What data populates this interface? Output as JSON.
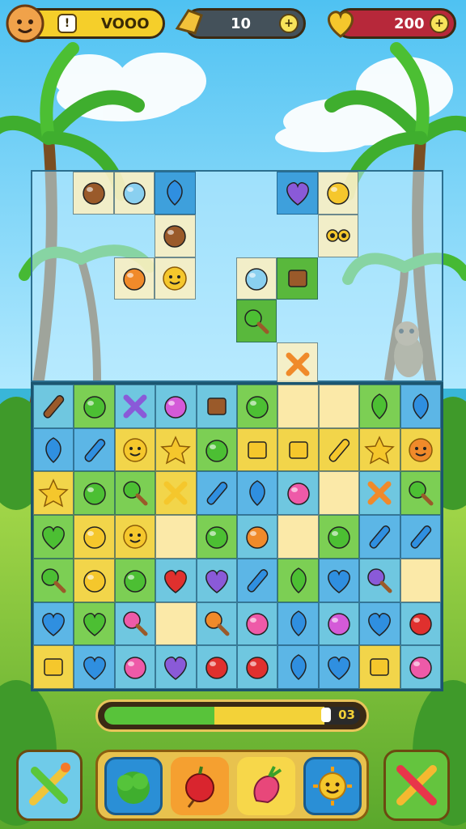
{
  "hud": {
    "coins": {
      "plus_label": "!",
      "value": "VOOO",
      "icon": "coin-icon"
    },
    "keys": {
      "value": "10",
      "icon": "bell-key-icon"
    },
    "hearts": {
      "value": "200",
      "icon": "heart-icon"
    }
  },
  "progress": {
    "fill": 0.86,
    "label": "03"
  },
  "colors": {
    "sky": "#7cd3f5",
    "grass": "#7cc63b",
    "board": "#1d6a85",
    "progress_green": "#58c33a",
    "progress_yellow": "#f3d238"
  },
  "upper_tiles": [
    {
      "c": 1,
      "r": 0,
      "icon": "acorn-icon"
    },
    {
      "c": 2,
      "r": 0,
      "icon": "honey-pot-icon"
    },
    {
      "c": 3,
      "r": 0,
      "icon": "blue-balloon-icon"
    },
    {
      "c": 6,
      "r": 0,
      "icon": "purple-heart-icon"
    },
    {
      "c": 7,
      "r": 0,
      "icon": "yellow-carrot-icon"
    },
    {
      "c": 3,
      "r": 1,
      "icon": "acorn-bag-icon"
    },
    {
      "c": 7,
      "r": 1,
      "icon": "eyes-icon"
    },
    {
      "c": 2,
      "r": 2,
      "icon": "orange-fruit-icon"
    },
    {
      "c": 3,
      "r": 2,
      "icon": "sun-face-icon"
    },
    {
      "c": 5,
      "r": 2,
      "icon": "sparkle-icon"
    },
    {
      "c": 6,
      "r": 2,
      "icon": "wood-log-icon"
    },
    {
      "c": 5,
      "r": 3,
      "icon": "green-drumstick-icon"
    },
    {
      "c": 6,
      "r": 4,
      "icon": "orange-twig-icon"
    }
  ],
  "lower_tiles": [
    [
      "cork-icon",
      "broccoli-icon",
      "purple-box-icon",
      "lollipop-icon",
      "chocolate-icon",
      "green-bottle-icon",
      "",
      "",
      "green-leaf-icon",
      "blue-gem-icon"
    ],
    [
      "blue-gem-icon",
      "blue-crayon-icon",
      "smiley-icon",
      "star-icon",
      "green-apple-icon",
      "cheese-icon",
      "gold-bar-icon",
      "banana-icon",
      "star-icon",
      "orange-smiley-icon"
    ],
    [
      "star-icon",
      "frog-icon",
      "green-drumstick-icon",
      "yellow-x-icon",
      "blue-pill-icon",
      "blue-balloon-icon",
      "pink-flower-icon",
      "",
      "orange-twig-icon",
      "green-drumstick-icon"
    ],
    [
      "green-heart-icon",
      "yellow-chick-icon",
      "smiley-icon",
      "",
      "green-frog-icon",
      "orange-fruit-icon",
      "",
      "green-frog-icon",
      "blue-pill-icon",
      "blue-pill-icon"
    ],
    [
      "green-drumstick-icon",
      "yellow-fish-icon",
      "broccoli-icon",
      "red-heart-icon",
      "purple-heart-icon",
      "blue-crayon-icon",
      "green-leaf-icon",
      "blue-heart-icon",
      "purple-key-icon",
      ""
    ],
    [
      "blue-heart-icon",
      "green-heart-icon",
      "pink-drumstick-icon",
      "",
      "orange-key-icon",
      "pink-fruit-icon",
      "blue-gem-icon",
      "candy-swirl-icon",
      "blue-heart-icon",
      "red-fruit-icon"
    ],
    [
      "cheese-icon",
      "blue-heart-icon",
      "pink-fruit-icon",
      "purple-heart-icon",
      "red-apple-icon",
      "red-apple-icon",
      "blue-gem-icon",
      "blue-heart-icon",
      "cheese-icon",
      "pink-candy-icon"
    ]
  ],
  "boosters": {
    "left": "magic-wand-icon",
    "items": [
      "bush-icon",
      "bomb-apple-icon",
      "dragon-fruit-icon",
      "sun-face-icon"
    ],
    "right": "crossed-wands-icon"
  }
}
